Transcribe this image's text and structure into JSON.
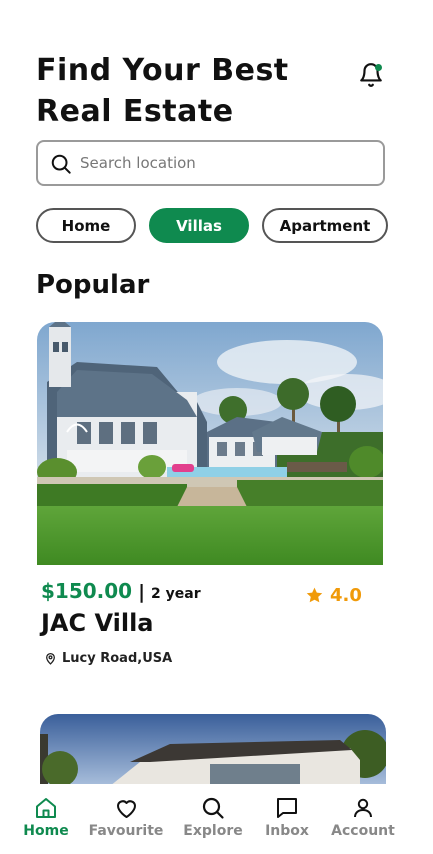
{
  "header": {
    "title": "Find Your Best Real Estate"
  },
  "search": {
    "placeholder": "Search location",
    "value": ""
  },
  "categories": [
    {
      "label": "Home",
      "active": false
    },
    {
      "label": "Villas",
      "active": true
    },
    {
      "label": "Apartment",
      "active": false
    }
  ],
  "section": {
    "title": "Popular"
  },
  "listing": {
    "price": "$150.00",
    "separator": "|",
    "period": "2 year",
    "rating": "4.0",
    "name": "JAC Villa",
    "location": "Lucy Road,USA"
  },
  "nav": [
    {
      "label": "Home",
      "icon": "home-icon",
      "active": true
    },
    {
      "label": "Favourite",
      "icon": "heart-icon",
      "active": false
    },
    {
      "label": "Explore",
      "icon": "search-icon",
      "active": false
    },
    {
      "label": "Inbox",
      "icon": "chat-icon",
      "active": false
    },
    {
      "label": "Account",
      "icon": "user-icon",
      "active": false
    }
  ],
  "colors": {
    "accent": "#0f8a4f",
    "rating": "#f09a0a"
  }
}
